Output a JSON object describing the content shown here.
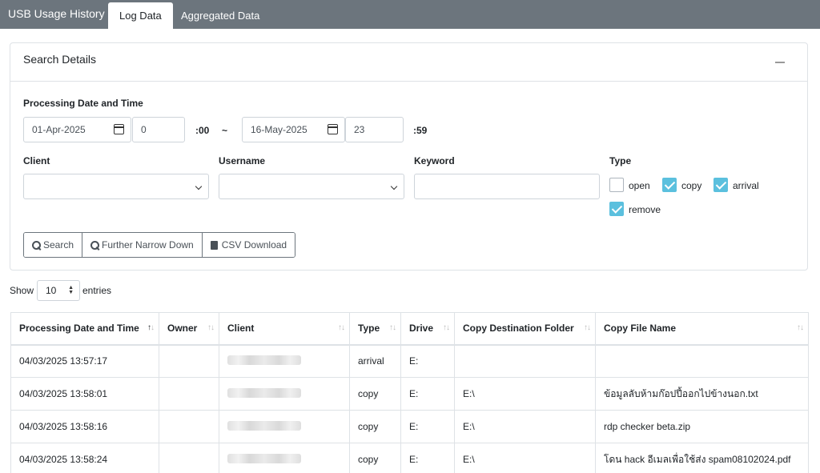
{
  "app": {
    "title": "USB Usage History"
  },
  "tabs": [
    {
      "label": "Log Data",
      "active": true
    },
    {
      "label": "Aggregated Data",
      "active": false
    }
  ],
  "search": {
    "title": "Search Details",
    "date_label": "Processing Date and Time",
    "from_date": "01-Apr-2025",
    "from_hour": "0",
    "from_suffix": ":00",
    "range_sep": "~",
    "to_date": "16-May-2025",
    "to_hour": "23",
    "to_suffix": ":59",
    "client_label": "Client",
    "client_value": "",
    "username_label": "Username",
    "username_value": "",
    "keyword_label": "Keyword",
    "keyword_value": "",
    "type_label": "Type",
    "types": [
      {
        "label": "open",
        "checked": false
      },
      {
        "label": "copy",
        "checked": true
      },
      {
        "label": "arrival",
        "checked": true
      },
      {
        "label": "remove",
        "checked": true
      }
    ],
    "buttons": {
      "search": "Search",
      "narrow": "Further Narrow Down",
      "csv": "CSV Download"
    }
  },
  "entries": {
    "show_label": "Show",
    "value": "10",
    "suffix": "entries"
  },
  "table": {
    "columns": [
      "Processing Date and Time",
      "Owner",
      "Client",
      "Type",
      "Drive",
      "Copy Destination Folder",
      "Copy File Name"
    ],
    "rows": [
      {
        "datetime": "04/03/2025 13:57:17",
        "owner": "",
        "type": "arrival",
        "drive": "E:",
        "folder": "",
        "file": ""
      },
      {
        "datetime": "04/03/2025 13:58:01",
        "owner": "",
        "type": "copy",
        "drive": "E:",
        "folder": "E:\\",
        "file": "ข้อมูลลับห้ามก๊อปปี้ออกไปข้างนอก.txt"
      },
      {
        "datetime": "04/03/2025 13:58:16",
        "owner": "",
        "type": "copy",
        "drive": "E:",
        "folder": "E:\\",
        "file": "rdp checker beta.zip"
      },
      {
        "datetime": "04/03/2025 13:58:24",
        "owner": "",
        "type": "copy",
        "drive": "E:",
        "folder": "E:\\",
        "file": "โดน hack อีเมลเพื่อใช้ส่ง spam08102024.pdf"
      }
    ]
  },
  "colors": {
    "topbar": "#6c757d",
    "checkbox_checked": "#5bc0de",
    "border": "#dee2e6"
  }
}
